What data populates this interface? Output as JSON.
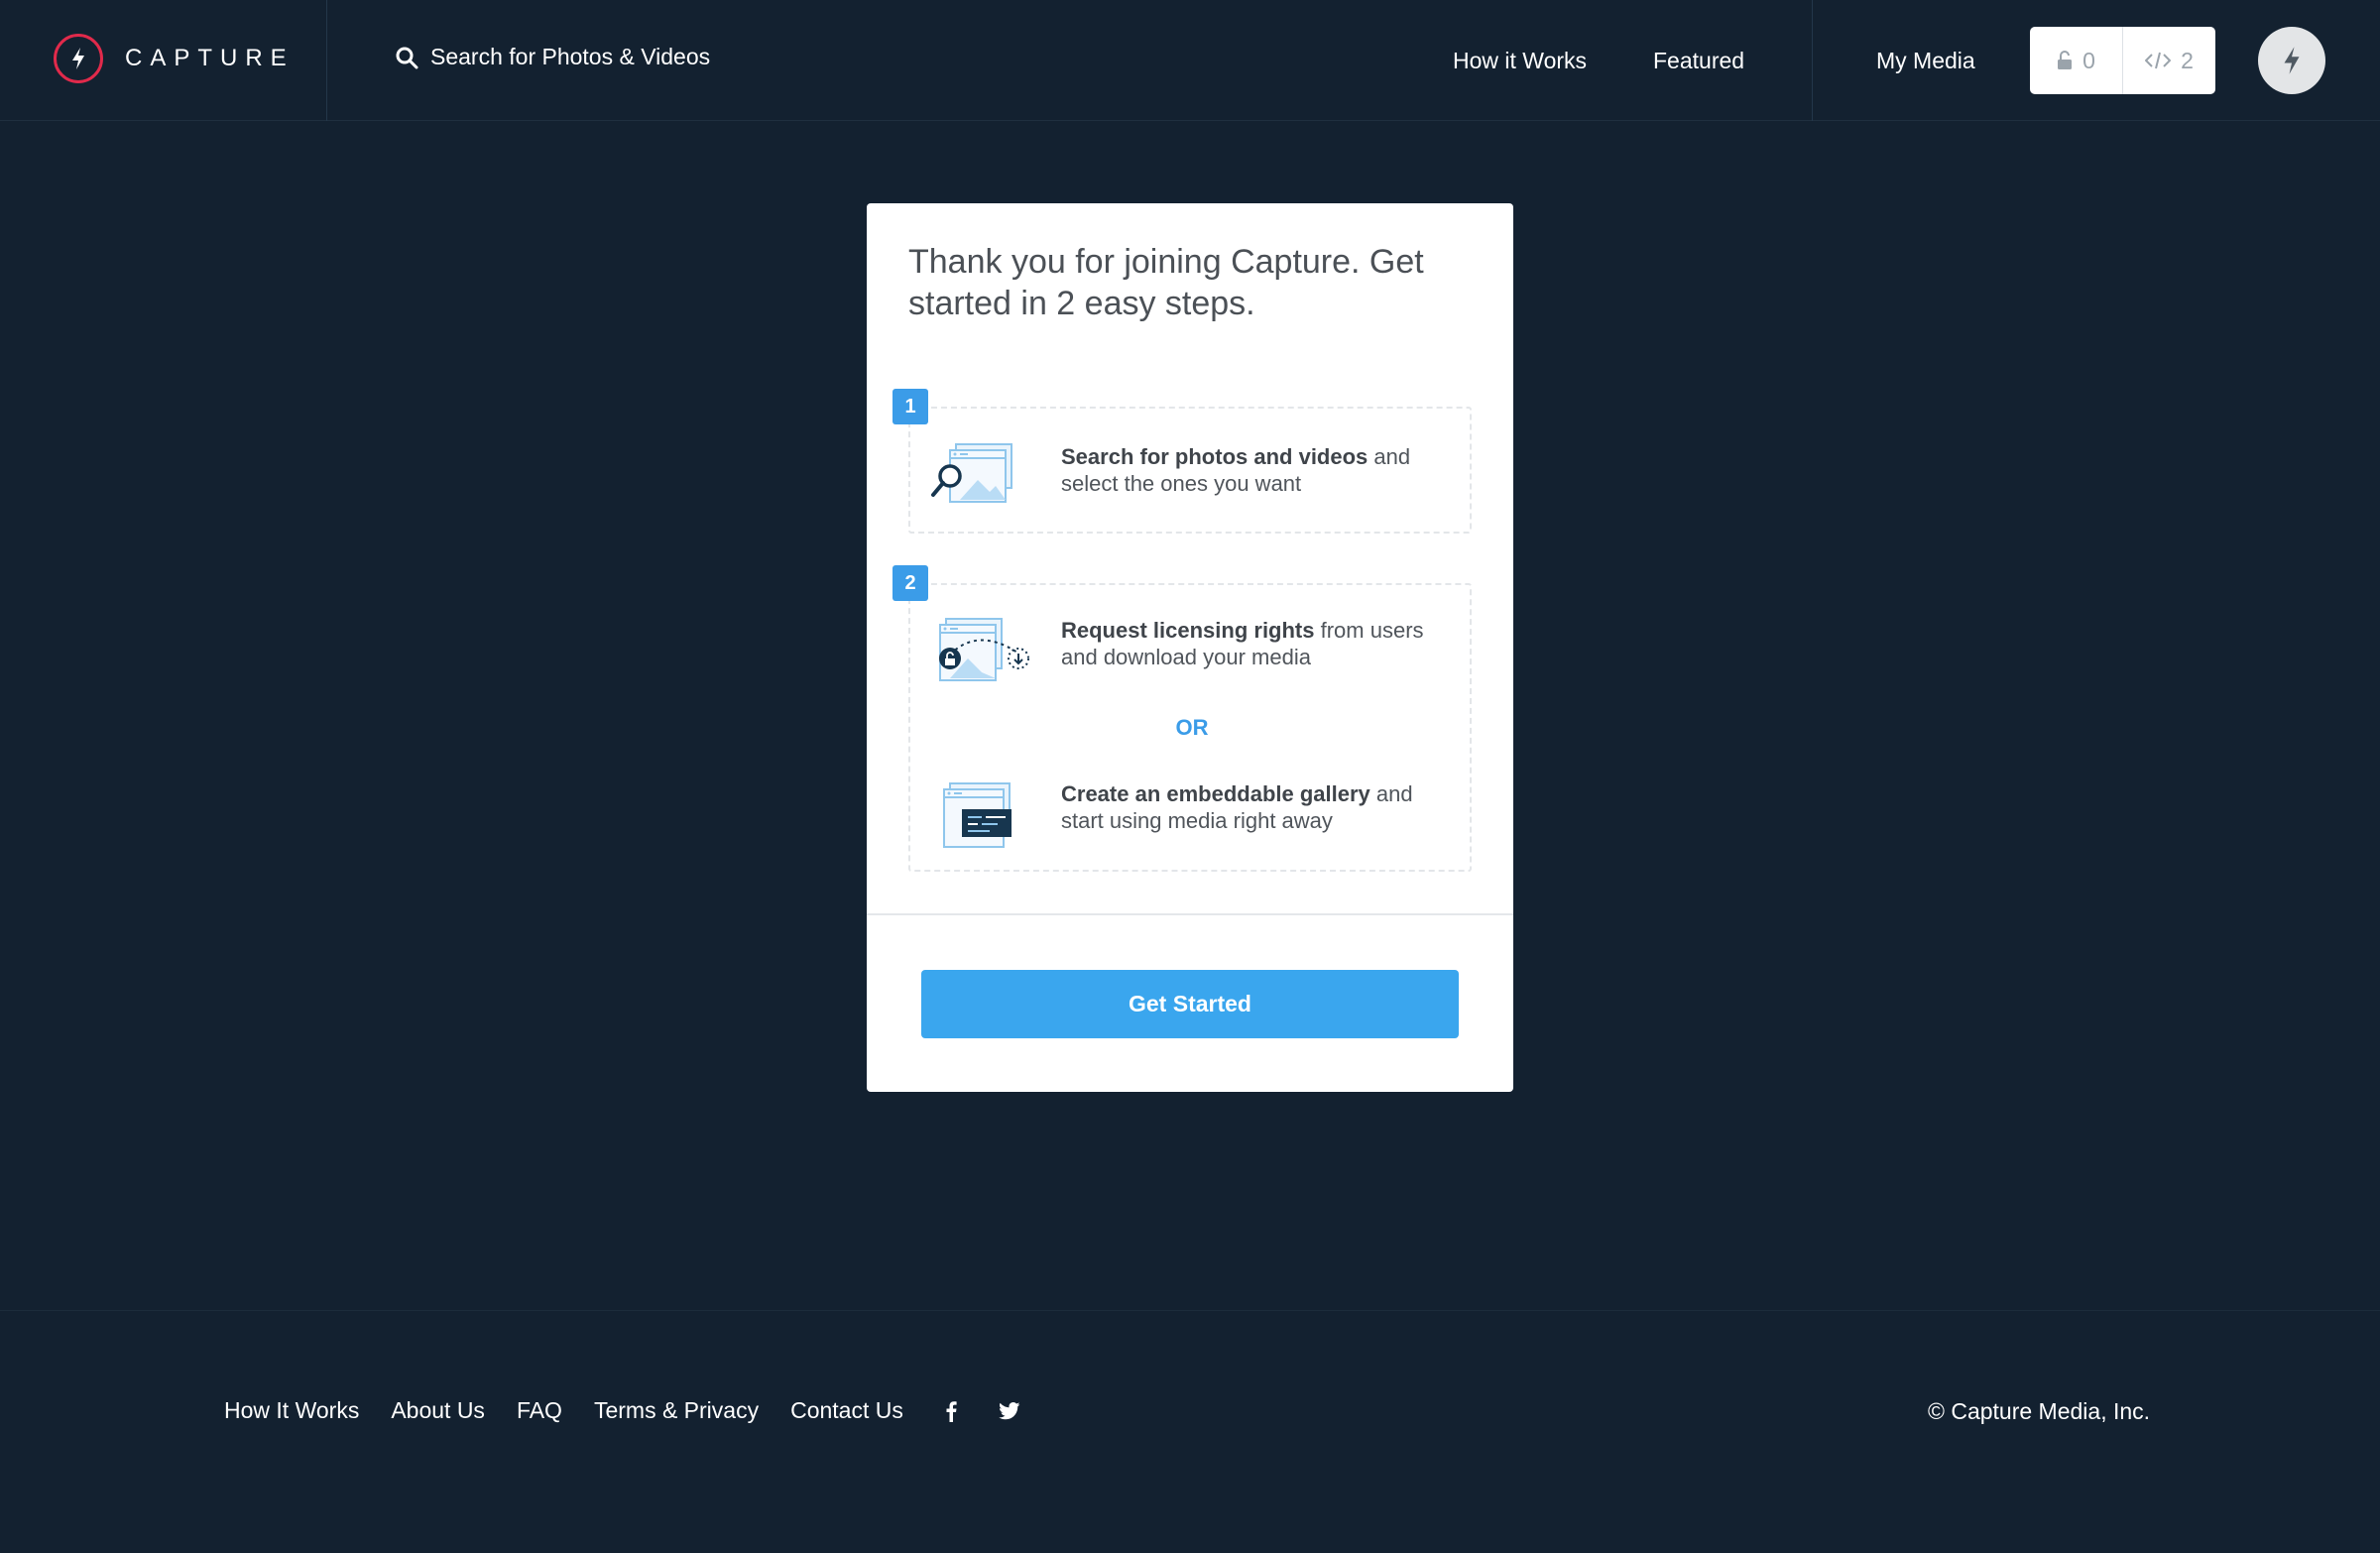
{
  "header": {
    "brand": "CAPTURE",
    "search_label": "Search for Photos & Videos",
    "nav": {
      "how_it_works": "How it Works",
      "featured": "Featured",
      "my_media": "My Media"
    },
    "counters": {
      "licensed": "0",
      "embeds": "2"
    }
  },
  "card": {
    "title": "Thank you for joining Capture. Get started in 2 easy steps.",
    "step1": {
      "badge": "1",
      "bold": "Search for photos and videos",
      "rest": " and select the ones you want"
    },
    "step2": {
      "badge": "2",
      "option_a_bold": "Request licensing rights",
      "option_a_rest": " from users and download your media",
      "or": "OR",
      "option_b_bold": "Create an embeddable gallery",
      "option_b_rest": " and start using media right away"
    },
    "cta": "Get Started"
  },
  "footer": {
    "links": [
      "How It Works",
      "About Us",
      "FAQ",
      "Terms & Privacy",
      "Contact Us"
    ],
    "copyright": "© Capture Media, Inc."
  },
  "colors": {
    "background": "#132130",
    "brand_red": "#e12a4b",
    "accent_blue": "#3aa6ee",
    "card": "#ffffff"
  }
}
